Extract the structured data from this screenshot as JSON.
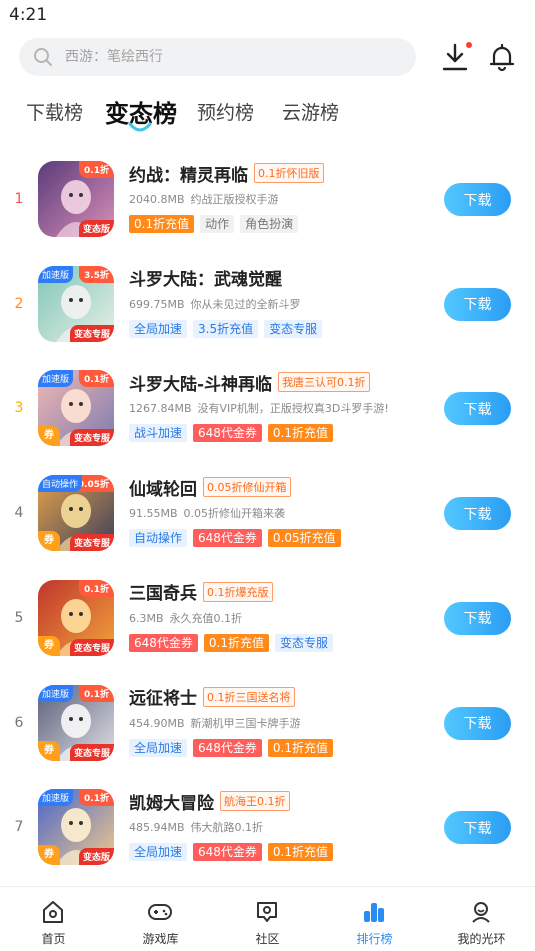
{
  "status": {
    "time": "4:21"
  },
  "search": {
    "placeholder": "西游：笔绘西行"
  },
  "tabs": [
    {
      "label": "下载榜"
    },
    {
      "label": "变态榜"
    },
    {
      "label": "预约榜"
    },
    {
      "label": "云游榜"
    }
  ],
  "games": [
    {
      "rank": "1",
      "name": "约战：精灵再临",
      "promo": "0.1折怀旧版",
      "size": "2040.8MB",
      "desc": "约战正版授权手游",
      "badge_tr": "0.1折",
      "badge_tl": "",
      "badge_br": "变态版",
      "badge_bl": "",
      "tags": [
        {
          "text": "0.1折充值",
          "style": "orange"
        },
        {
          "text": "动作",
          "style": "gray"
        },
        {
          "text": "角色扮演",
          "style": "gray"
        }
      ],
      "button": "下载"
    },
    {
      "rank": "2",
      "name": "斗罗大陆：武魂觉醒",
      "promo": "",
      "size": "699.75MB",
      "desc": "你从未见过的全新斗罗",
      "badge_tr": "3.5折",
      "badge_tl": "加速版",
      "badge_br": "变态专服",
      "badge_bl": "",
      "tags": [
        {
          "text": "全局加速",
          "style": "blue"
        },
        {
          "text": "3.5折充值",
          "style": "blue"
        },
        {
          "text": "变态专服",
          "style": "blue"
        }
      ],
      "button": "下载"
    },
    {
      "rank": "3",
      "name": "斗罗大陆-斗神再临",
      "promo": "我唐三认可0.1折",
      "size": "1267.84MB",
      "desc": "没有VIP机制，正版授权真3D斗罗手游!",
      "badge_tr": "0.1折",
      "badge_tl": "加速版",
      "badge_br": "变态专服",
      "badge_bl": "券",
      "tags": [
        {
          "text": "战斗加速",
          "style": "blue"
        },
        {
          "text": "648代金券",
          "style": "red"
        },
        {
          "text": "0.1折充值",
          "style": "orange"
        }
      ],
      "button": "下载"
    },
    {
      "rank": "4",
      "name": "仙域轮回",
      "promo": "0.05折修仙开箱",
      "size": "91.55MB",
      "desc": "0.05折修仙开箱来袭",
      "badge_tr": "0.05折",
      "badge_tl": "自动操作",
      "badge_br": "变态专服",
      "badge_bl": "券",
      "tags": [
        {
          "text": "自动操作",
          "style": "blue"
        },
        {
          "text": "648代金券",
          "style": "red"
        },
        {
          "text": "0.05折充值",
          "style": "orange"
        }
      ],
      "button": "下载"
    },
    {
      "rank": "5",
      "name": "三国奇兵",
      "promo": "0.1折爆充版",
      "size": "6.3MB",
      "desc": "永久充值0.1折",
      "badge_tr": "0.1折",
      "badge_tl": "",
      "badge_br": "变态专服",
      "badge_bl": "券",
      "tags": [
        {
          "text": "648代金券",
          "style": "red"
        },
        {
          "text": "0.1折充值",
          "style": "orange"
        },
        {
          "text": "变态专服",
          "style": "blue"
        }
      ],
      "button": "下载"
    },
    {
      "rank": "6",
      "name": "远征将士",
      "promo": "0.1折三国送名将",
      "size": "454.90MB",
      "desc": "新潮机甲三国卡牌手游",
      "badge_tr": "0.1折",
      "badge_tl": "加速版",
      "badge_br": "变态专服",
      "badge_bl": "券",
      "tags": [
        {
          "text": "全局加速",
          "style": "blue"
        },
        {
          "text": "648代金券",
          "style": "red"
        },
        {
          "text": "0.1折充值",
          "style": "orange"
        }
      ],
      "button": "下载"
    },
    {
      "rank": "7",
      "name": "凯姆大冒险",
      "promo": "航海王0.1折",
      "size": "485.94MB",
      "desc": "伟大航路0.1折",
      "badge_tr": "0.1折",
      "badge_tl": "加速版",
      "badge_br": "变态版",
      "badge_bl": "券",
      "tags": [
        {
          "text": "全局加速",
          "style": "blue"
        },
        {
          "text": "648代金券",
          "style": "red"
        },
        {
          "text": "0.1折充值",
          "style": "orange"
        }
      ],
      "button": "下载"
    }
  ],
  "icon_art": [
    {
      "bg1": "#5a3b7a",
      "bg2": "#d98fb8",
      "accent": "#f3d3e4"
    },
    {
      "bg1": "#7fc6b6",
      "bg2": "#e8efe6",
      "accent": "#f2f2f2"
    },
    {
      "bg1": "#f2b9b2",
      "bg2": "#7e7bb0",
      "accent": "#ffe3d4"
    },
    {
      "bg1": "#e7a24a",
      "bg2": "#3b3f5c",
      "accent": "#f5dd9a"
    },
    {
      "bg1": "#c0362c",
      "bg2": "#f1a33b",
      "accent": "#ffe0a0"
    },
    {
      "bg1": "#5b5f79",
      "bg2": "#dedfe6",
      "accent": "#f8f8f8"
    },
    {
      "bg1": "#4a66c9",
      "bg2": "#f0c98c",
      "accent": "#fff1d0"
    }
  ],
  "nav": [
    {
      "label": "首页",
      "icon": "home-icon"
    },
    {
      "label": "游戏库",
      "icon": "gamepad-icon"
    },
    {
      "label": "社区",
      "icon": "community-icon"
    },
    {
      "label": "排行榜",
      "icon": "ranking-icon"
    },
    {
      "label": "我的光环",
      "icon": "profile-icon"
    }
  ],
  "colors": {
    "accent": "#2a8df0",
    "rank1": "#ff4d4f",
    "rank2": "#ff8a1f",
    "rank3": "#f5b400",
    "promo": "#ff6a1a"
  }
}
